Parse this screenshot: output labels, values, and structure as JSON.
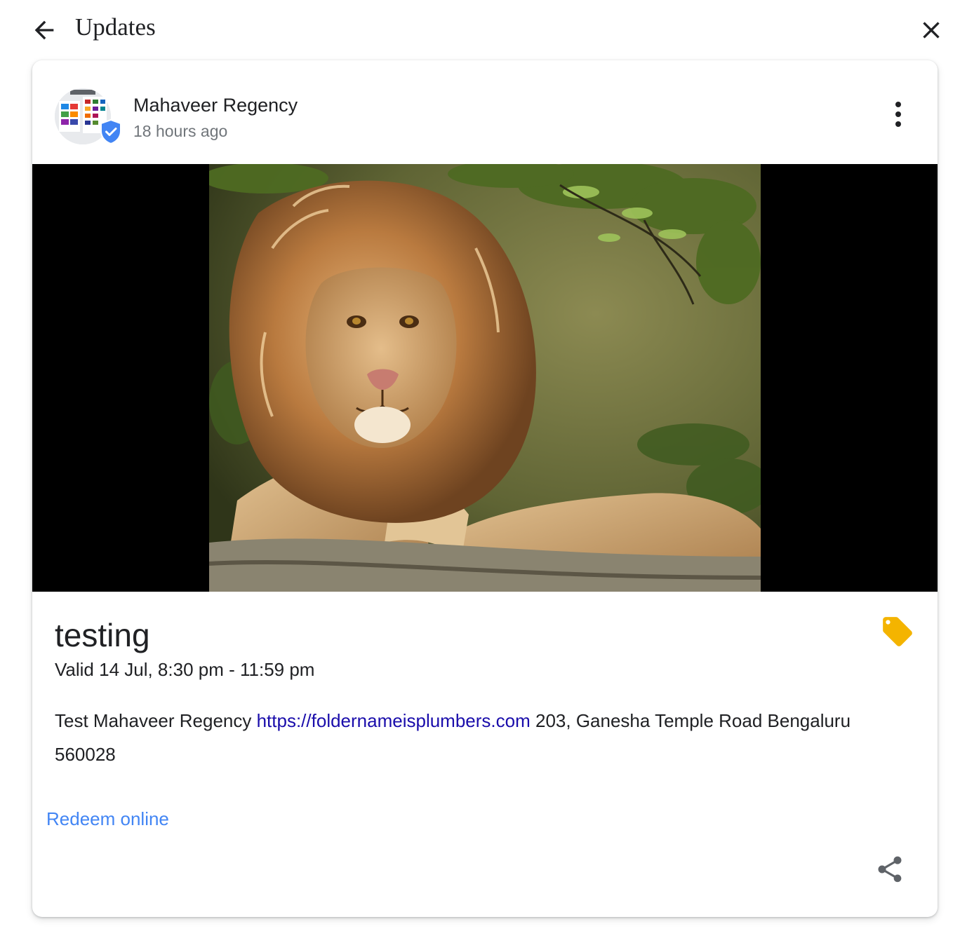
{
  "topbar": {
    "title": "Updates",
    "back_icon": "arrow-back-icon",
    "close_icon": "close-icon"
  },
  "post": {
    "author": "Mahaveer Regency",
    "time_ago": "18 hours ago",
    "verified": true,
    "title": "testing",
    "validity": "Valid 14 Jul, 8:30 pm - 11:59 pm",
    "description_prefix": "Test Mahaveer Regency ",
    "link_text": "https://foldernameisplumbers.com",
    "description_suffix": " 203, Ganesha Temple Road Bengaluru 560028",
    "redeem_label": "Redeem online"
  },
  "colors": {
    "link": "#1a0dab",
    "action": "#4285f4",
    "tag": "#f4b400",
    "badge": "#4285f4",
    "secondary_text": "#70757a"
  }
}
